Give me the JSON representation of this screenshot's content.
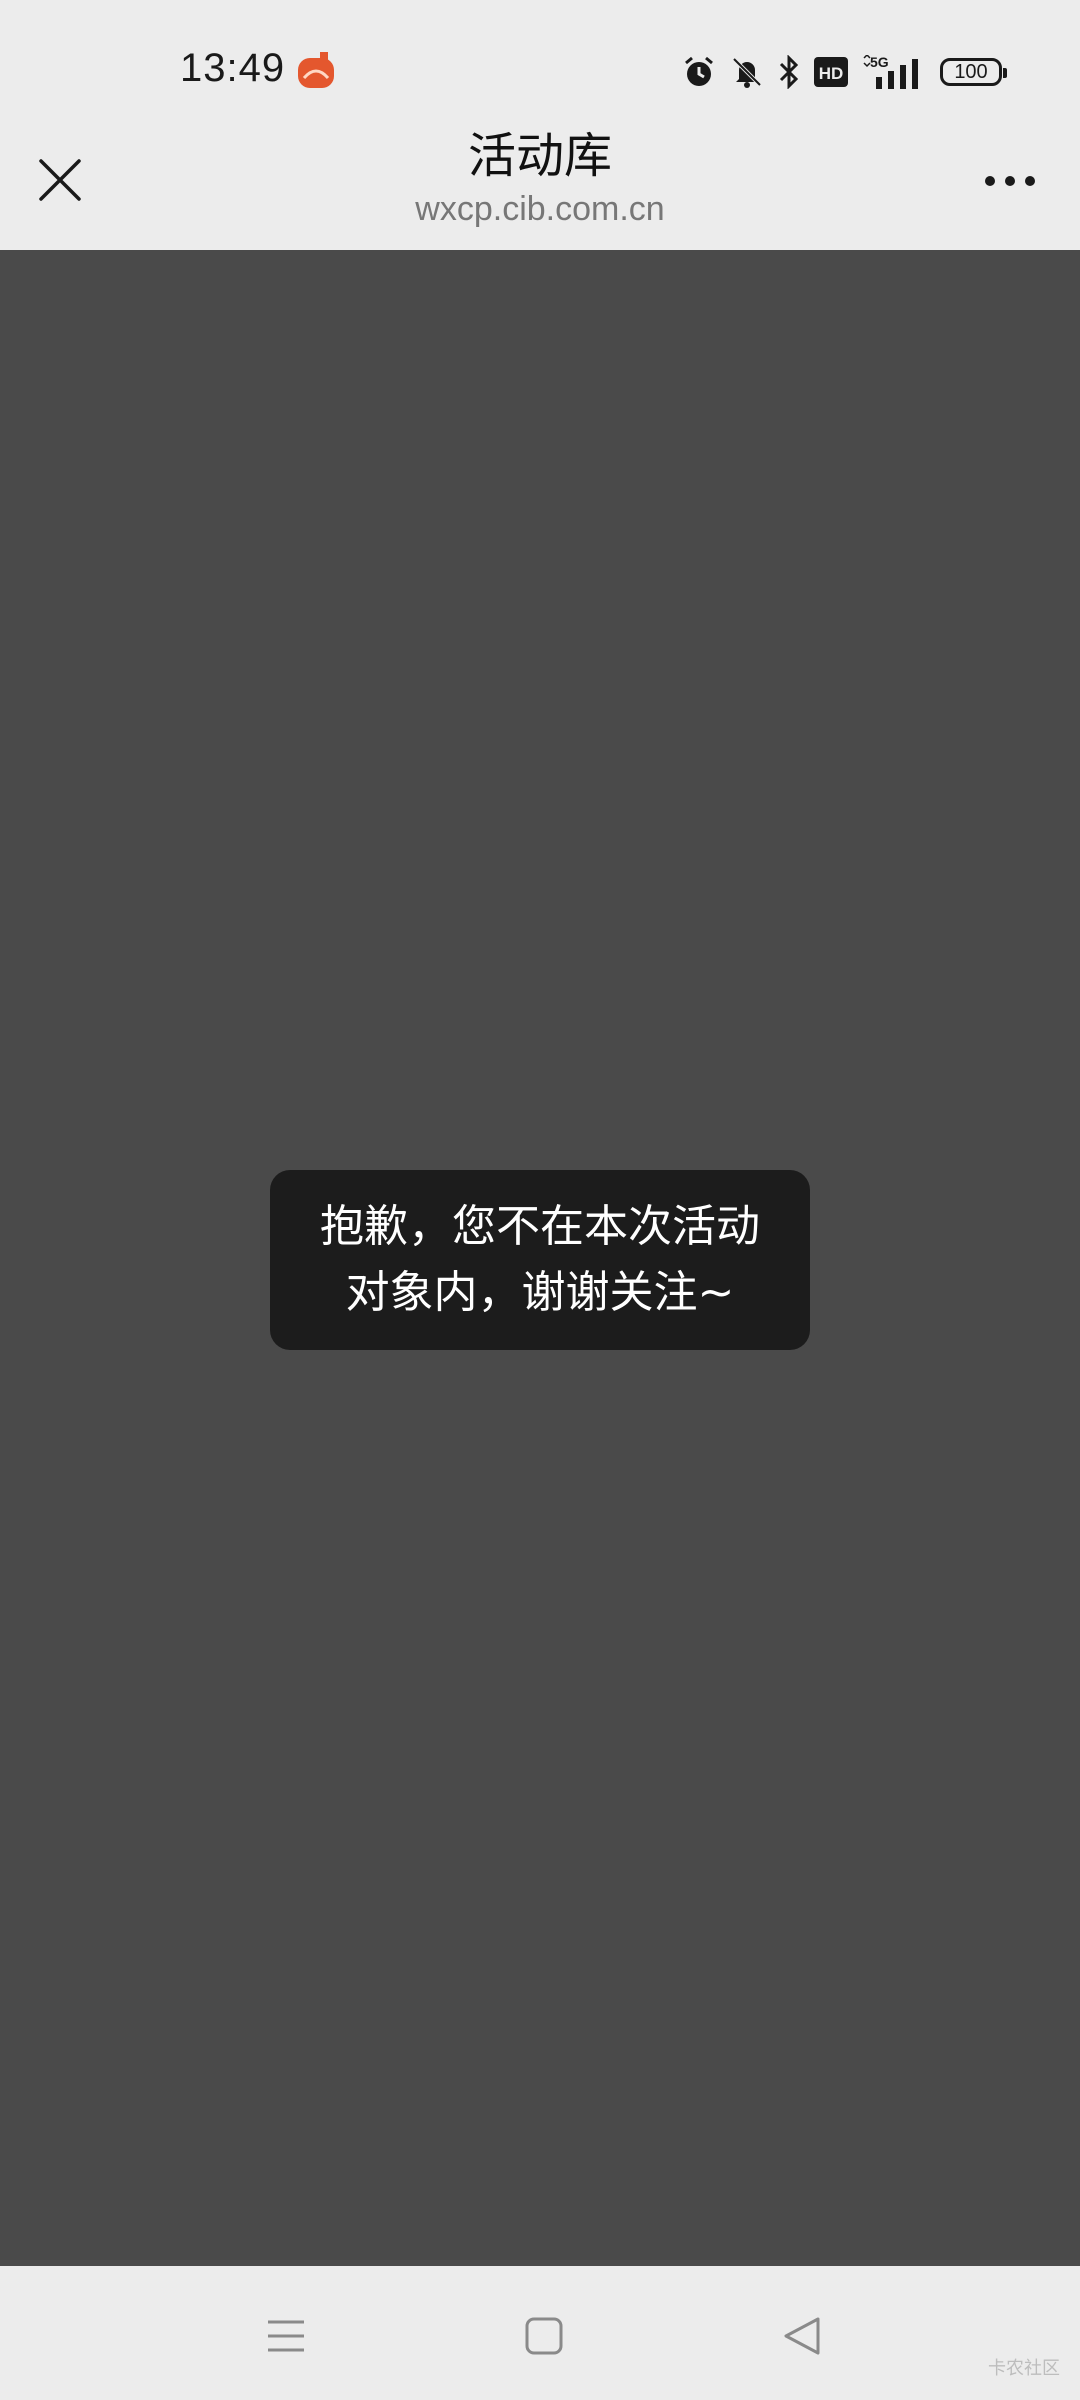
{
  "status_bar": {
    "time": "13:49",
    "battery": "100",
    "icons": [
      "app-notification-icon",
      "alarm-icon",
      "bell-off-icon",
      "bluetooth-icon",
      "hd-icon",
      "5g-signal-icon",
      "battery-icon"
    ]
  },
  "header": {
    "title": "活动库",
    "url": "wxcp.cib.com.cn"
  },
  "toast": {
    "line1": "抱歉，您不在本次活动",
    "line2": "对象内，谢谢关注~"
  },
  "watermark": "卡农社区",
  "colors": {
    "content_bg": "#4a4a4a",
    "toast_bg": "#1c1c1c",
    "bar_bg": "#ececec"
  }
}
